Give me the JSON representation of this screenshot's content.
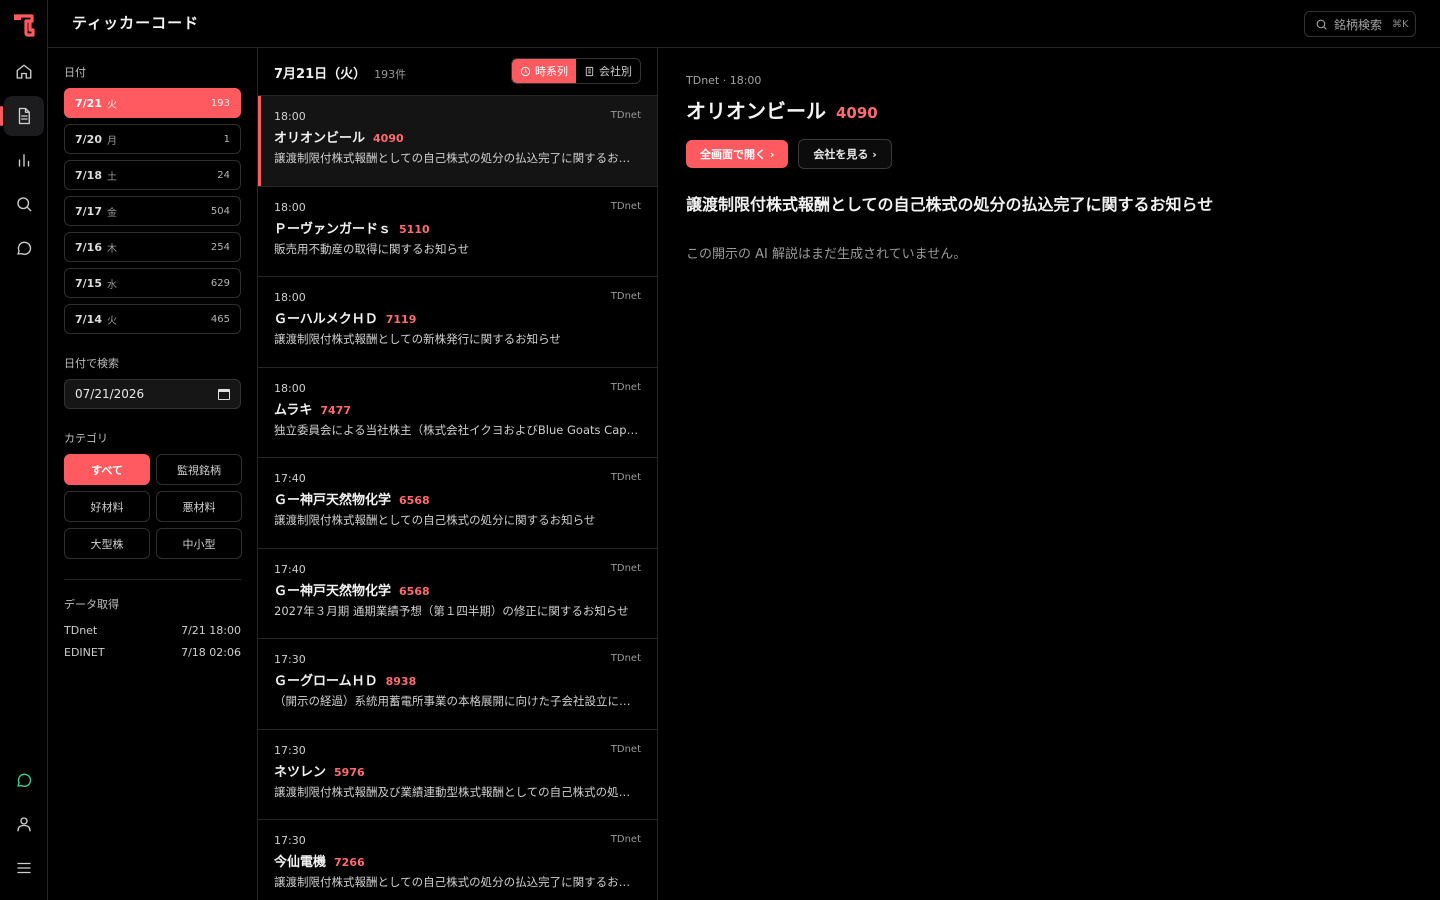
{
  "app": {
    "title": "ティッカーコード"
  },
  "search": {
    "label": "銘柄検索",
    "shortcut": "⌘K"
  },
  "filters": {
    "date_label": "日付",
    "dates": [
      {
        "date": "7/21",
        "weekday": "火",
        "count": "193",
        "active": true
      },
      {
        "date": "7/20",
        "weekday": "月",
        "count": "1"
      },
      {
        "date": "7/18",
        "weekday": "土",
        "count": "24"
      },
      {
        "date": "7/17",
        "weekday": "金",
        "count": "504"
      },
      {
        "date": "7/16",
        "weekday": "木",
        "count": "254"
      },
      {
        "date": "7/15",
        "weekday": "水",
        "count": "629"
      },
      {
        "date": "7/14",
        "weekday": "火",
        "count": "465"
      }
    ],
    "date_search_label": "日付で検索",
    "date_search_value": "07/21/2026",
    "category_label": "カテゴリ",
    "categories": [
      "すべて",
      "監視銘柄",
      "好材料",
      "悪材料",
      "大型株",
      "中小型"
    ],
    "fetch_label": "データ取得",
    "fetch": [
      {
        "source": "TDnet",
        "time": "7/21 18:00"
      },
      {
        "source": "EDINET",
        "time": "7/18 02:06"
      }
    ]
  },
  "list": {
    "date": "7月21日（火）",
    "count": "193件",
    "toggle_time": "時系列",
    "toggle_company": "会社別",
    "items": [
      {
        "time": "18:00",
        "source": "TDnet",
        "company": "オリオンビール",
        "code": "4090",
        "desc": "譲渡制限付株式報酬としての自己株式の処分の払込完了に関するお知らせ"
      },
      {
        "time": "18:00",
        "source": "TDnet",
        "company": "Ｐーヴァンガードｓ",
        "code": "5110",
        "desc": "販売用不動産の取得に関するお知らせ"
      },
      {
        "time": "18:00",
        "source": "TDnet",
        "company": "ＧーハルメクＨＤ",
        "code": "7119",
        "desc": "譲渡制限付株式報酬としての新株発行に関するお知らせ"
      },
      {
        "time": "18:00",
        "source": "TDnet",
        "company": "ムラキ",
        "code": "7477",
        "desc": "独立委員会による当社株主（株式会社イクヨおよびBlue Goats Capital）に関するお知らせ"
      },
      {
        "time": "17:40",
        "source": "TDnet",
        "company": "Ｇー神戸天然物化学",
        "code": "6568",
        "desc": "譲渡制限付株式報酬としての自己株式の処分に関するお知らせ"
      },
      {
        "time": "17:40",
        "source": "TDnet",
        "company": "Ｇー神戸天然物化学",
        "code": "6568",
        "desc": "2027年３月期 通期業績予想（第１四半期）の修正に関するお知らせ"
      },
      {
        "time": "17:30",
        "source": "TDnet",
        "company": "ＧーグロームＨＤ",
        "code": "8938",
        "desc": "（開示の経過）系統用蓄電所事業の本格展開に向けた子会社設立に関するお知らせ"
      },
      {
        "time": "17:30",
        "source": "TDnet",
        "company": "ネツレン",
        "code": "5976",
        "desc": "譲渡制限付株式報酬及び業績連動型株式報酬としての自己株式の処分に関するお知らせ"
      },
      {
        "time": "17:30",
        "source": "TDnet",
        "company": "今仙電機",
        "code": "7266",
        "desc": "譲渡制限付株式報酬としての自己株式の処分の払込完了に関するお知らせ"
      }
    ]
  },
  "detail": {
    "meta": "TDnet · 18:00",
    "company": "オリオンビール",
    "code": "4090",
    "open_full": "全画面で開く ›",
    "view_company": "会社を見る ›",
    "heading": "譲渡制限付株式報酬としての自己株式の処分の払込完了に関するお知らせ",
    "note": "この開示の AI 解説はまだ生成されていません。"
  },
  "colors": {
    "accent": "#ff5a5f",
    "green": "#34d399",
    "background": "#000000"
  }
}
